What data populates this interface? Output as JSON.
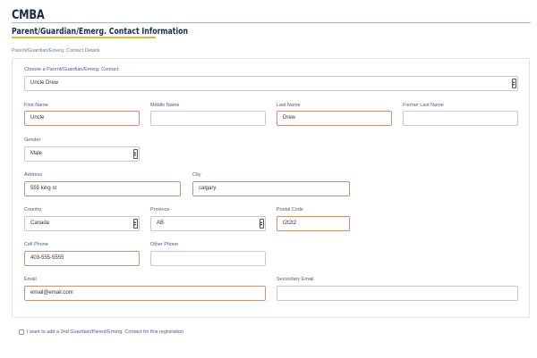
{
  "header": {
    "title": "CMBA",
    "section_title": "Parent/Guardian/Emerg. Contact Information"
  },
  "breadcrumb": "Parent/Guardian/Emerg. Contact Details",
  "contact_select": {
    "label": "Choose a Parent/Guardian/Emerg. Contact",
    "value": "Uncle Drew"
  },
  "form": {
    "first_name": {
      "label": "First Name",
      "value": "Uncle"
    },
    "middle_name": {
      "label": "Middle Name",
      "value": ""
    },
    "last_name": {
      "label": "Last Name",
      "value": "Drew"
    },
    "former_last_name": {
      "label": "Former Last Name",
      "value": ""
    },
    "gender": {
      "label": "Gender",
      "value": "Male"
    },
    "address": {
      "label": "Address",
      "value": "555 king st"
    },
    "city": {
      "label": "City",
      "value": "calgary"
    },
    "country": {
      "label": "Country",
      "value": "Canada"
    },
    "province": {
      "label": "Province",
      "value": "AB"
    },
    "postal_code": {
      "label": "Postal Code",
      "value": "t2t2t2"
    },
    "cell_phone": {
      "label": "Cell Phone",
      "value": "403-555-5555"
    },
    "other_phone": {
      "label": "Other Phone",
      "value": ""
    },
    "email": {
      "label": "Email",
      "value": "email@email.com"
    },
    "secondary_email": {
      "label": "Secondary Email",
      "value": ""
    }
  },
  "second_contact": {
    "label": "I want to add a 2nd Guardian/Parent/Emerg. Contact for this registration",
    "checked": false
  },
  "colors": {
    "accent_rule": "#e3b53a",
    "title": "#1d2a4d",
    "label": "#4b5a86",
    "required_border": "#c8917a"
  }
}
